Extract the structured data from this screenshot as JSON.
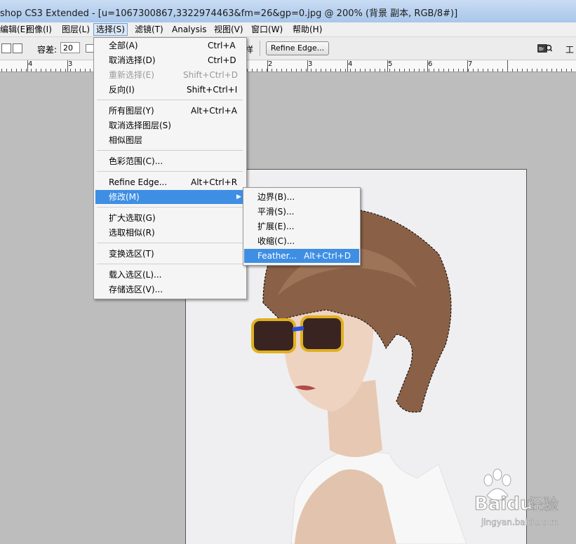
{
  "title": "shop CS3 Extended - [u=1067300867,3322974463&fm=26&gp=0.jpg @ 200% (背景 副本, RGB/8#)]",
  "menubar": [
    {
      "label": "编辑(E)",
      "active": false
    },
    {
      "label": "图像(I)",
      "active": false
    },
    {
      "label": "图层(L)",
      "active": false
    },
    {
      "label": "选择(S)",
      "active": true
    },
    {
      "label": "滤镜(T)",
      "active": false
    },
    {
      "label": "Analysis",
      "active": false
    },
    {
      "label": "视图(V)",
      "active": false
    },
    {
      "label": "窗口(W)",
      "active": false
    },
    {
      "label": "帮助(H)",
      "active": false
    }
  ],
  "options": {
    "tolerance_label": "容差:",
    "tolerance_value": "20",
    "sample_all_label": "样",
    "refine_edge_button": "Refine Edge...",
    "work_label": "工"
  },
  "ruler": {
    "labels": [
      "4",
      "3",
      "2",
      "3",
      "4",
      "5",
      "6",
      "7"
    ]
  },
  "select_menu": [
    {
      "type": "item",
      "label": "全部(A)",
      "shortcut": "Ctrl+A"
    },
    {
      "type": "item",
      "label": "取消选择(D)",
      "shortcut": "Ctrl+D"
    },
    {
      "type": "item",
      "label": "重新选择(E)",
      "shortcut": "Shift+Ctrl+D",
      "disabled": true
    },
    {
      "type": "item",
      "label": "反向(I)",
      "shortcut": "Shift+Ctrl+I"
    },
    {
      "type": "sep"
    },
    {
      "type": "item",
      "label": "所有图层(Y)",
      "shortcut": "Alt+Ctrl+A"
    },
    {
      "type": "item",
      "label": "取消选择图层(S)",
      "shortcut": ""
    },
    {
      "type": "item",
      "label": "相似图层",
      "shortcut": ""
    },
    {
      "type": "sep"
    },
    {
      "type": "item",
      "label": "色彩范围(C)...",
      "shortcut": ""
    },
    {
      "type": "sep"
    },
    {
      "type": "item",
      "label": "Refine Edge...",
      "shortcut": "Alt+Ctrl+R"
    },
    {
      "type": "item",
      "label": "修改(M)",
      "shortcut": "",
      "highlighted": true,
      "submenu": true
    },
    {
      "type": "sep"
    },
    {
      "type": "item",
      "label": "扩大选取(G)",
      "shortcut": ""
    },
    {
      "type": "item",
      "label": "选取相似(R)",
      "shortcut": ""
    },
    {
      "type": "sep"
    },
    {
      "type": "item",
      "label": "变换选区(T)",
      "shortcut": ""
    },
    {
      "type": "sep"
    },
    {
      "type": "item",
      "label": "载入选区(L)...",
      "shortcut": ""
    },
    {
      "type": "item",
      "label": "存储选区(V)...",
      "shortcut": ""
    }
  ],
  "modify_submenu": [
    {
      "label": "边界(B)...",
      "shortcut": ""
    },
    {
      "label": "平滑(S)...",
      "shortcut": ""
    },
    {
      "label": "扩展(E)...",
      "shortcut": ""
    },
    {
      "label": "收缩(C)...",
      "shortcut": ""
    },
    {
      "label": "Feather...",
      "shortcut": "Alt+Ctrl+D",
      "highlighted": true
    }
  ],
  "watermark": {
    "brand": "Baidu",
    "brand_cn": "经验",
    "url": "jingyan.baidu.com"
  },
  "colors": {
    "highlight": "#3e8fe4",
    "canvas_bg": "#bdbdbd",
    "titlebar": "#b7d0ef"
  }
}
